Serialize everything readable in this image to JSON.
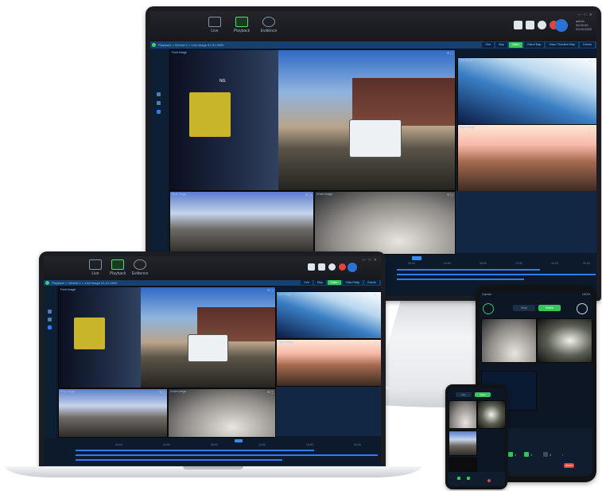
{
  "nav": {
    "items": [
      {
        "label": "Live"
      },
      {
        "label": "Playback"
      },
      {
        "label": "Evidence"
      }
    ]
  },
  "user": {
    "line1": "admin",
    "line2": "00:00:00",
    "line3": "00:00:0000"
  },
  "window_controls": "— □ ✕",
  "breadcrumb": "Playback > Vehicle 1 > Live image 01-01-0000",
  "layout_buttons": [
    {
      "label": "Grid"
    },
    {
      "label": "Map"
    },
    {
      "label": "Video"
    },
    {
      "label": "Video+Map"
    },
    {
      "label": "Video+Timeline+Map"
    },
    {
      "label": "Events"
    }
  ],
  "cameras": {
    "main": {
      "label": "Front Image"
    },
    "rear": {
      "label": "Left Image"
    },
    "side": {
      "label": "Right Image"
    },
    "cab1": {
      "label": "Rear Image"
    },
    "cab2": {
      "label": "Driver Image"
    }
  },
  "main_overlay": "NG",
  "timeline": {
    "ticks": [
      "00:00",
      "04:00",
      "08:00",
      "12:00",
      "16:00",
      "20:00",
      "24:00"
    ]
  },
  "phone": {
    "status_left": "Carrier",
    "status_right": "100%",
    "tabs": [
      {
        "label": "Map"
      },
      {
        "label": "Video"
      }
    ],
    "bottom_counts": [
      "1",
      "1",
      "4"
    ],
    "bottom_red": "Alarm"
  },
  "colors": {
    "accent_green": "#37c55a",
    "accent_blue": "#2d7cf0",
    "bg_dark": "#0e1a2b"
  }
}
